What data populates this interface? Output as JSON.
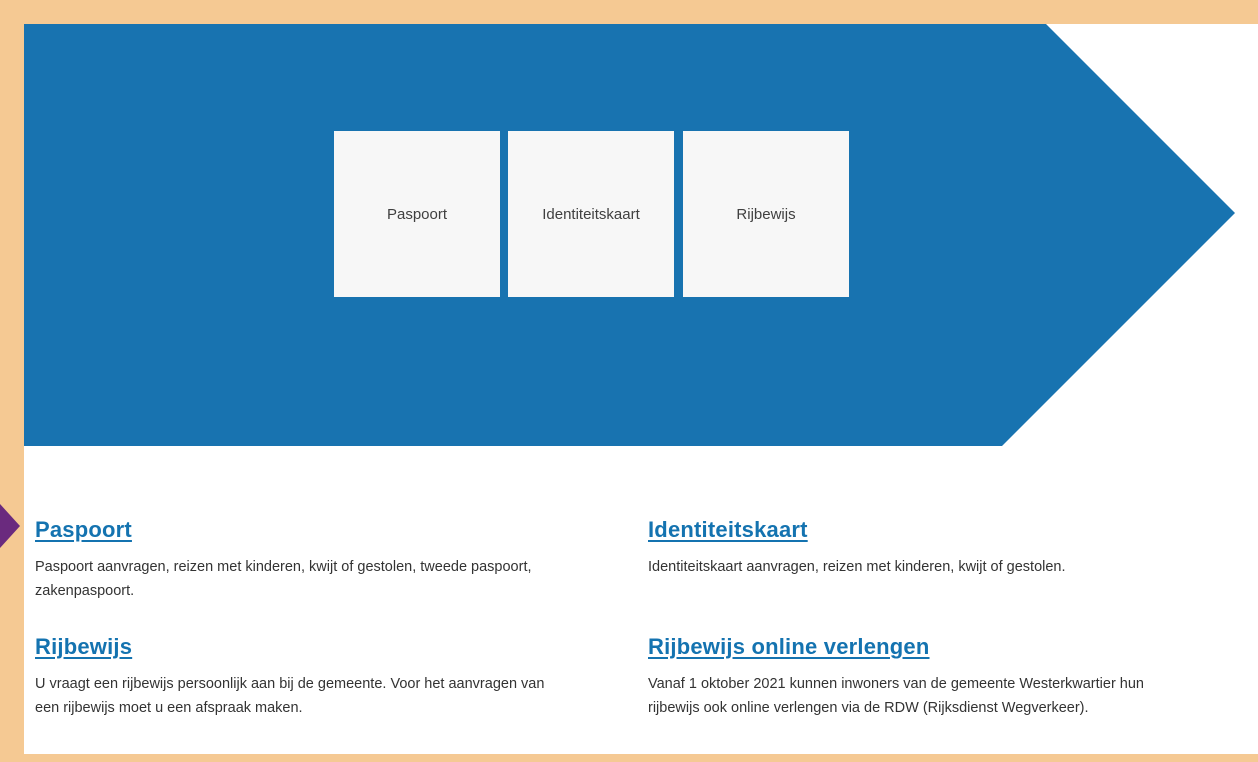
{
  "colors": {
    "frame": "#f5c993",
    "hero": "#1873b0",
    "tile": "#f7f7f7",
    "link": "#1473b0",
    "marker": "#6a2a7e"
  },
  "tiles": [
    {
      "label": "Paspoort"
    },
    {
      "label": "Identiteitskaart"
    },
    {
      "label": "Rijbewijs"
    }
  ],
  "links": [
    {
      "title": "Paspoort",
      "description": "Paspoort aanvragen, reizen met kinderen, kwijt of gestolen, tweede paspoort, zakenpaspoort."
    },
    {
      "title": "Identiteitskaart",
      "description": "Identiteitskaart aanvragen, reizen met kinderen, kwijt of gestolen."
    },
    {
      "title": "Rijbewijs",
      "description": "U vraagt een rijbewijs persoonlijk aan bij de gemeente. Voor het aanvragen van een rijbewijs moet u een afspraak maken."
    },
    {
      "title": "Rijbewijs online verlengen",
      "description": "Vanaf 1 oktober 2021 kunnen inwoners van de gemeente Westerkwartier hun rijbewijs ook online verlengen via de RDW (Rijksdienst Wegverkeer)."
    }
  ]
}
